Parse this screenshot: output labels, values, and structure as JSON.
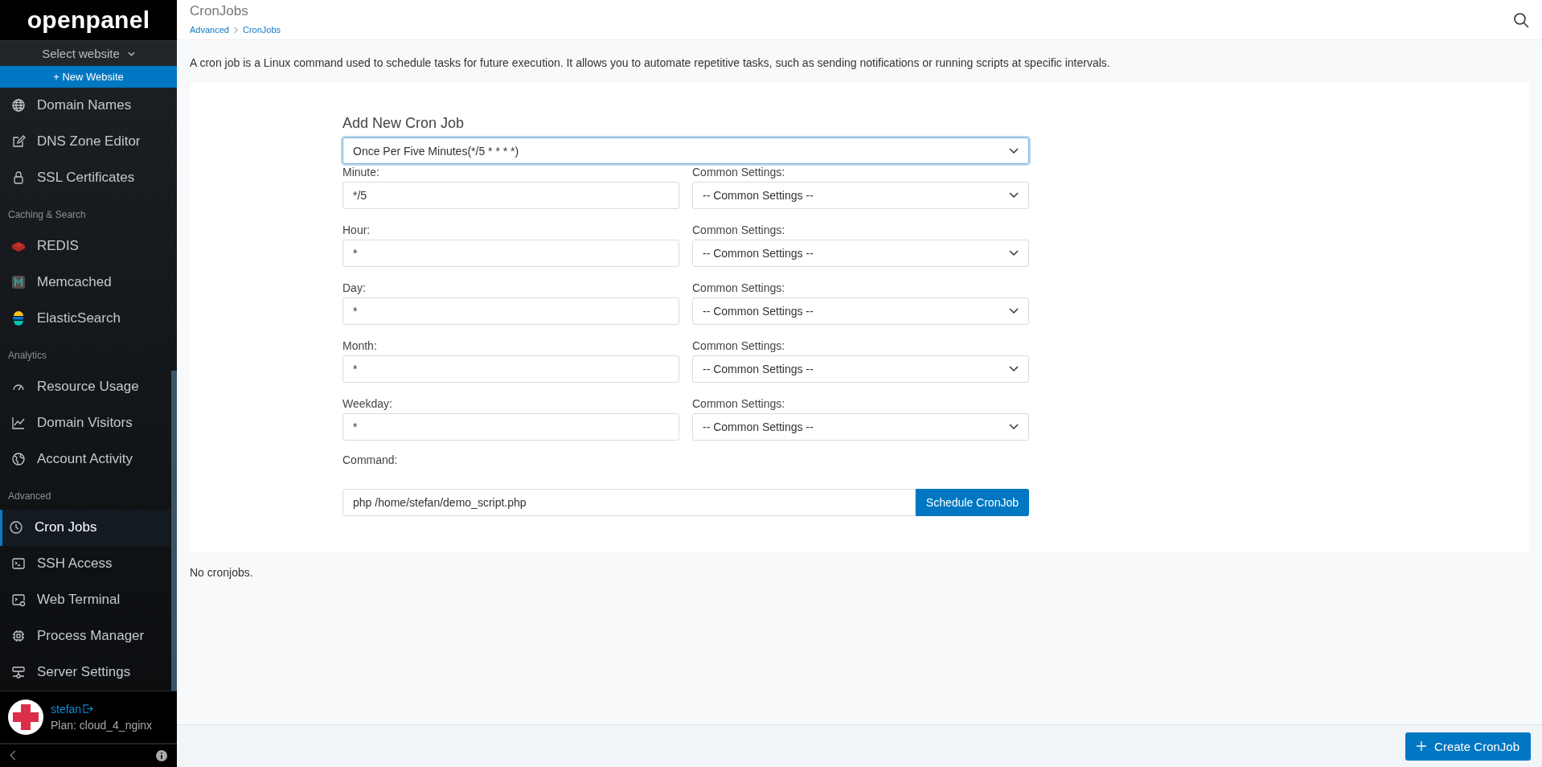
{
  "sidebar": {
    "logo": "openpanel",
    "website_select": "Select website",
    "new_website": "+ New Website",
    "groups": [
      {
        "items": [
          {
            "label": "Domain Names",
            "selected": false
          },
          {
            "label": "DNS Zone Editor",
            "selected": false
          },
          {
            "label": "SSL Certificates",
            "selected": false
          }
        ]
      },
      {
        "title": "Caching & Search",
        "items": [
          {
            "label": "REDIS",
            "selected": false
          },
          {
            "label": "Memcached",
            "selected": false
          },
          {
            "label": "ElasticSearch",
            "selected": false
          }
        ]
      },
      {
        "title": "Analytics",
        "items": [
          {
            "label": "Resource Usage",
            "selected": false
          },
          {
            "label": "Domain Visitors",
            "selected": false
          },
          {
            "label": "Account Activity",
            "selected": false
          }
        ]
      },
      {
        "title": "Advanced",
        "items": [
          {
            "label": "Cron Jobs",
            "selected": true
          },
          {
            "label": "SSH Access",
            "selected": false
          },
          {
            "label": "Web Terminal",
            "selected": false
          },
          {
            "label": "Process Manager",
            "selected": false
          },
          {
            "label": "Server Settings",
            "selected": false
          }
        ]
      }
    ],
    "user": {
      "name": "stefan",
      "plan": "Plan: cloud_4_nginx"
    }
  },
  "header": {
    "title": "CronJobs",
    "breadcrumb": [
      "Advanced",
      "CronJobs"
    ]
  },
  "description": "A cron job is a Linux command used to schedule tasks for future execution. It allows you to automate repetitive tasks, such as sending notifications or running scripts at specific intervals.",
  "form": {
    "title": "Add New Cron Job",
    "preset": "Once Per Five Minutes(*/5 * * * *)",
    "fields": [
      {
        "label": "Minute:",
        "value": "*/5",
        "common_label": "Common Settings:",
        "common_value": "-- Common Settings --"
      },
      {
        "label": "Hour:",
        "value": "*",
        "common_label": "Common Settings:",
        "common_value": "-- Common Settings --"
      },
      {
        "label": "Day:",
        "value": "*",
        "common_label": "Common Settings:",
        "common_value": "-- Common Settings --"
      },
      {
        "label": "Month:",
        "value": "*",
        "common_label": "Common Settings:",
        "common_value": "-- Common Settings --"
      },
      {
        "label": "Weekday:",
        "value": "*",
        "common_label": "Common Settings:",
        "common_value": "-- Common Settings --"
      }
    ],
    "command_label": "Command:",
    "command": "php /home/stefan/demo_script.php",
    "submit": "Schedule CronJob"
  },
  "empty_message": "No cronjobs.",
  "footer": {
    "button": "Create CronJob"
  }
}
